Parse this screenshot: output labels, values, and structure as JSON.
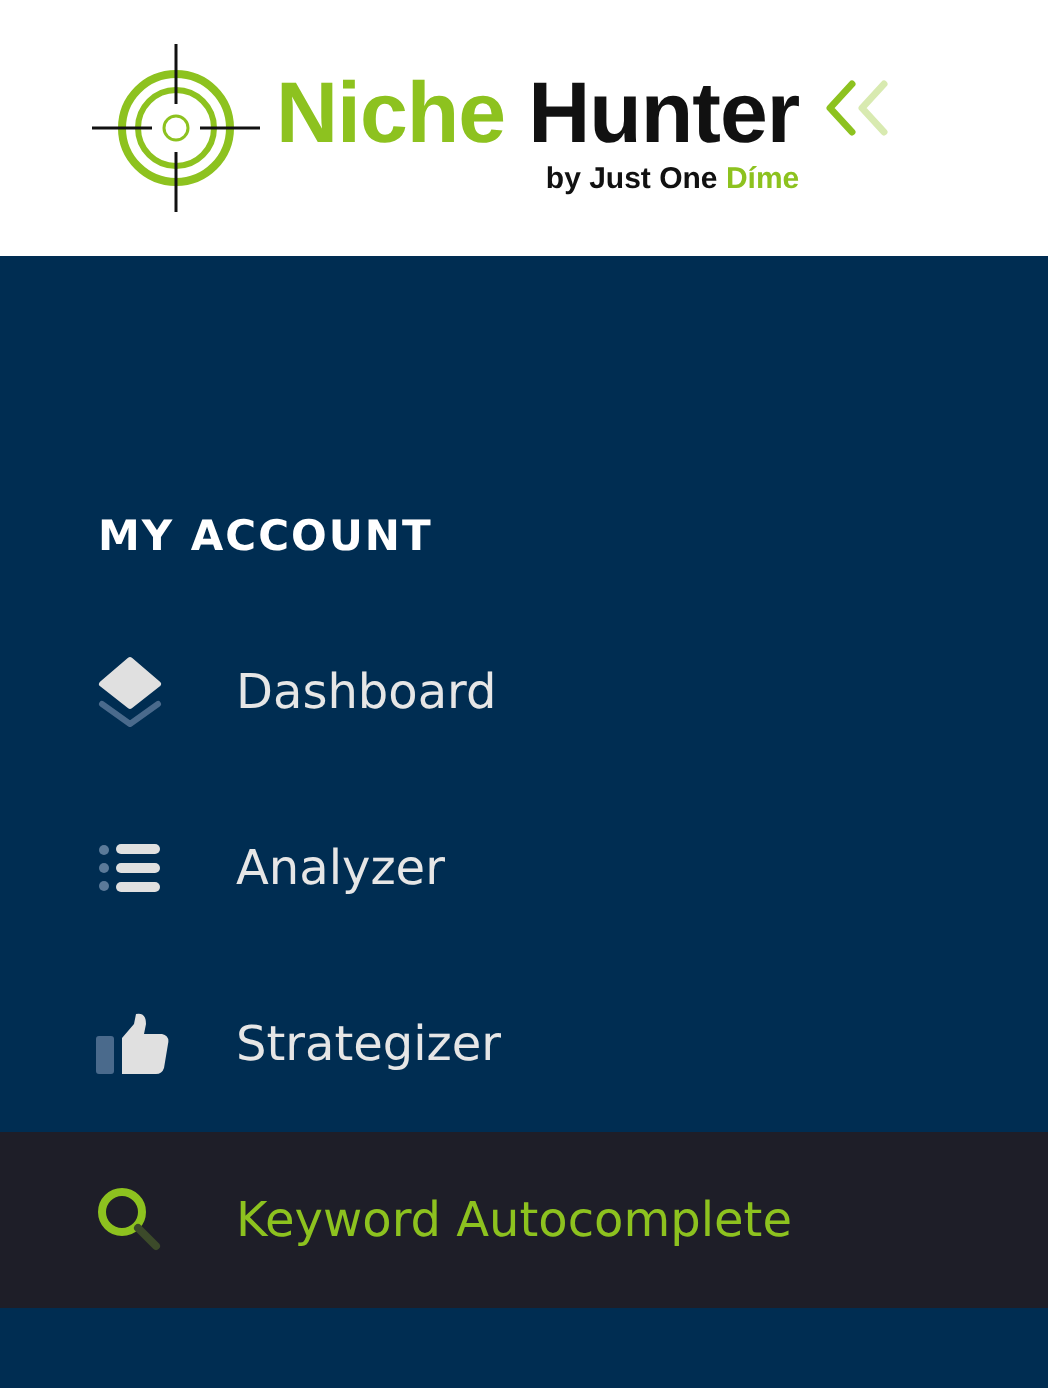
{
  "logo": {
    "name_first": "Niche",
    "name_second": "Hunter",
    "tagline_prefix": "by Just One",
    "tagline_accent": "Díme"
  },
  "sidebar": {
    "heading": "MY ACCOUNT",
    "items": [
      {
        "label": "Dashboard",
        "kind": "layers",
        "selected": false
      },
      {
        "label": "Analyzer",
        "kind": "list",
        "selected": false
      },
      {
        "label": "Strategizer",
        "kind": "thumb",
        "selected": false
      },
      {
        "label": "Keyword Autocomplete",
        "kind": "search",
        "selected": true
      }
    ]
  }
}
